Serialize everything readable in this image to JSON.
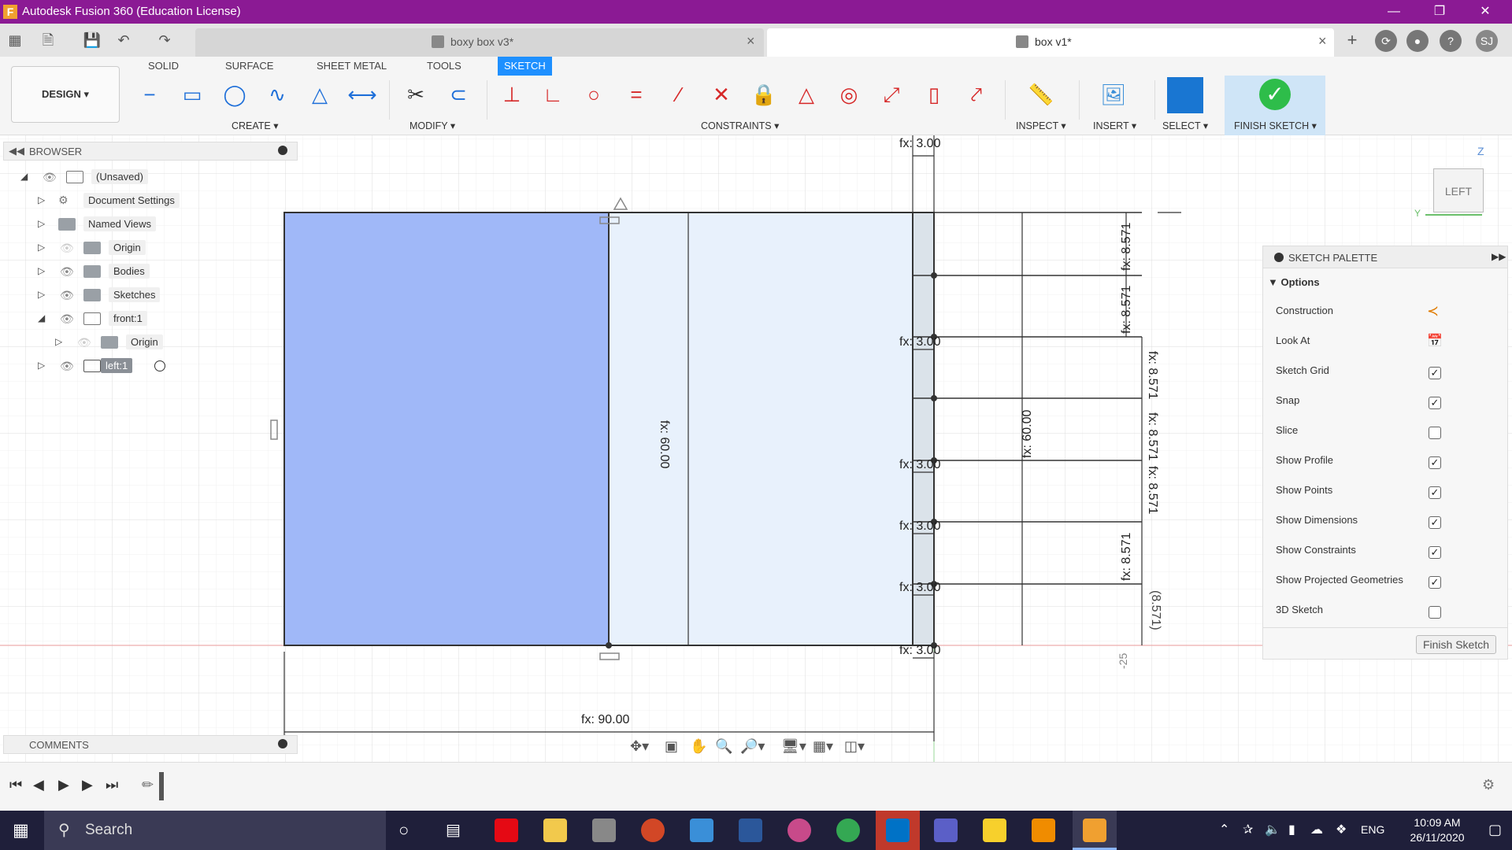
{
  "window": {
    "title": "Autodesk Fusion 360 (Education License)",
    "app_icon": "F"
  },
  "tabs": [
    {
      "label": "boxy box v3*",
      "active": false
    },
    {
      "label": "box v1*",
      "active": true
    }
  ],
  "user_initials": "SJ",
  "ribbon": {
    "workspace": "DESIGN",
    "tabs": [
      "SOLID",
      "SURFACE",
      "SHEET METAL",
      "TOOLS",
      "SKETCH"
    ],
    "active_tab": "SKETCH",
    "groups": {
      "create": "CREATE",
      "modify": "MODIFY",
      "constraints": "CONSTRAINTS",
      "inspect": "INSPECT",
      "insert": "INSERT",
      "select": "SELECT",
      "finish": "FINISH SKETCH"
    }
  },
  "browser": {
    "title": "BROWSER",
    "items": [
      {
        "label": "(Unsaved)",
        "level": 0,
        "expanded": true
      },
      {
        "label": "Document Settings",
        "level": 1
      },
      {
        "label": "Named Views",
        "level": 1
      },
      {
        "label": "Origin",
        "level": 1
      },
      {
        "label": "Bodies",
        "level": 1
      },
      {
        "label": "Sketches",
        "level": 1
      },
      {
        "label": "front:1",
        "level": 1,
        "expanded": true
      },
      {
        "label": "Origin",
        "level": 2
      },
      {
        "label": "left:1",
        "level": 1,
        "selected": true
      }
    ]
  },
  "comments": {
    "title": "COMMENTS"
  },
  "sketch_palette": {
    "title": "SKETCH PALETTE",
    "section": "Options",
    "options": [
      {
        "label": "Construction",
        "type": "icon"
      },
      {
        "label": "Look At",
        "type": "icon"
      },
      {
        "label": "Sketch Grid",
        "checked": true
      },
      {
        "label": "Snap",
        "checked": true
      },
      {
        "label": "Slice",
        "checked": false
      },
      {
        "label": "Show Profile",
        "checked": true
      },
      {
        "label": "Show Points",
        "checked": true
      },
      {
        "label": "Show Dimensions",
        "checked": true
      },
      {
        "label": "Show Constraints",
        "checked": true
      },
      {
        "label": "Show Projected Geometries",
        "checked": true
      },
      {
        "label": "3D Sketch",
        "checked": false
      }
    ],
    "finish_button": "Finish Sketch"
  },
  "viewcube": {
    "face": "LEFT",
    "axis_z": "Z",
    "axis_y": "Y"
  },
  "dimensions": {
    "top": "fx: 3.00",
    "width": "fx: 90.00",
    "height_left": "fx: 60.00",
    "height_right": "fx: 60.00",
    "small_dims": [
      "fx: 3.00",
      "fx: 3.00",
      "fx: 3.00",
      "fx: 3.00",
      "fx: 3.00"
    ],
    "spacing": [
      "fx: 8.571",
      "fx: 8.571",
      "fx: 8.571",
      "fx: 8.571",
      "fx: 8.571",
      "fx: 8.571",
      "(8.571)"
    ],
    "ruler_right": "-25"
  },
  "taskbar": {
    "search_placeholder": "Search",
    "language": "ENG",
    "time": "10:09 AM",
    "date": "26/11/2020"
  }
}
